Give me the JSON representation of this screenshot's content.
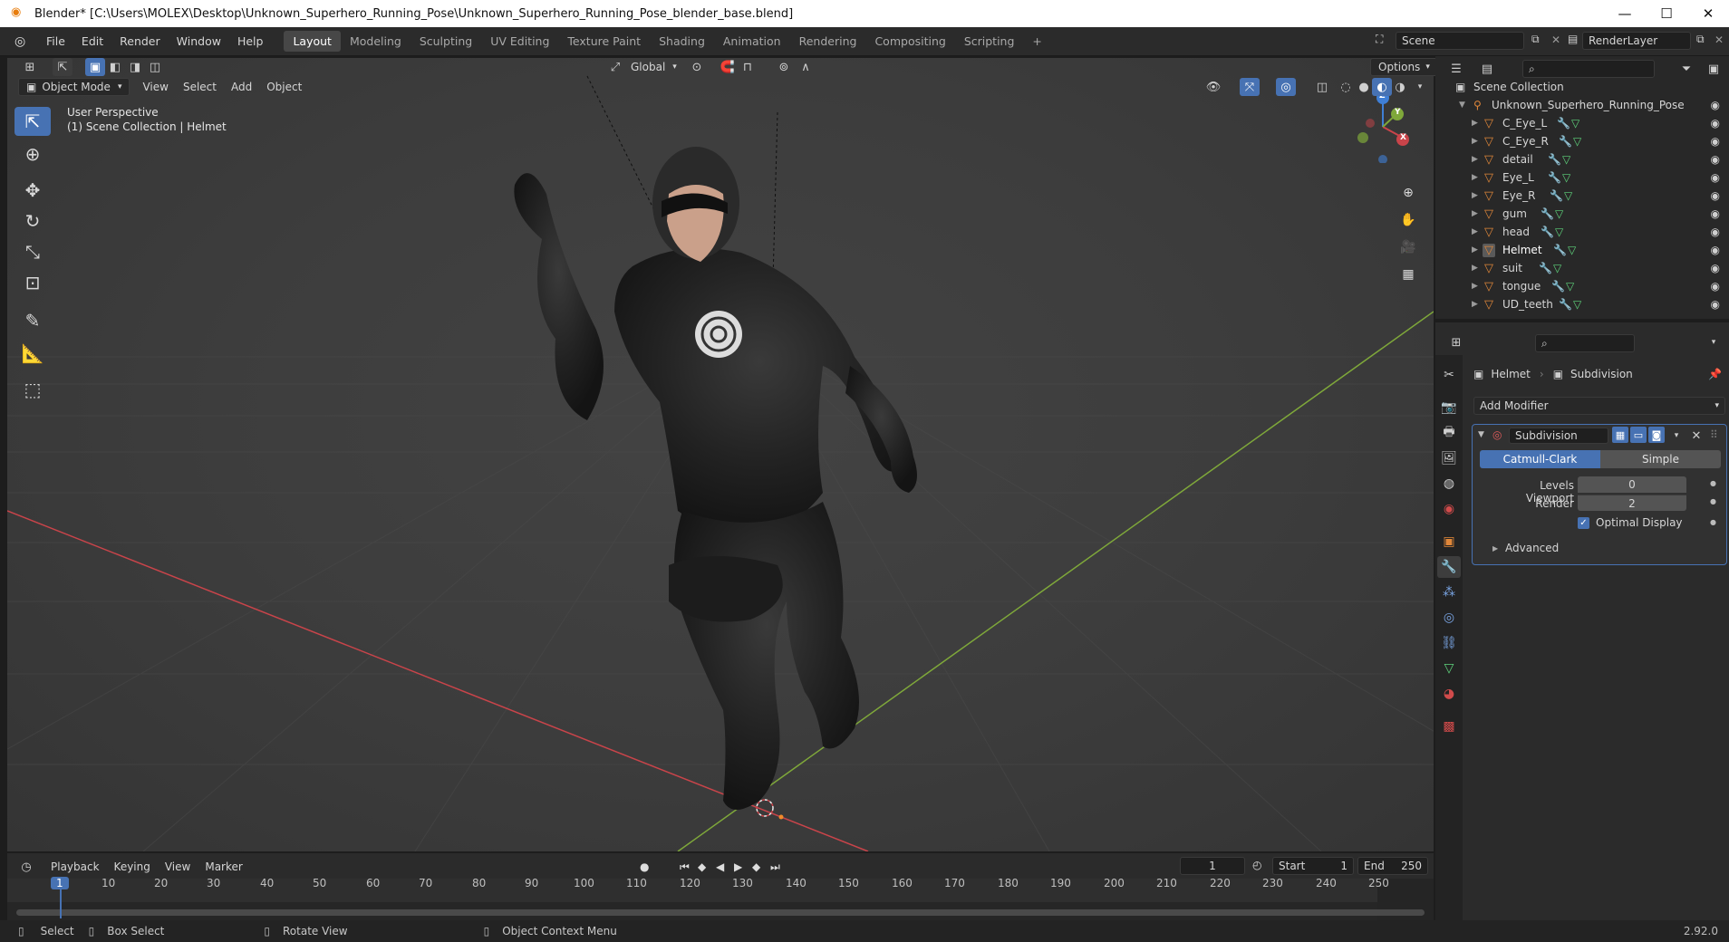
{
  "window": {
    "title": "Blender* [C:\\Users\\MOLEX\\Desktop\\Unknown_Superhero_Running_Pose\\Unknown_Superhero_Running_Pose_blender_base.blend]",
    "minimize": "—",
    "maximize": "☐",
    "close": "✕"
  },
  "menu": [
    "File",
    "Edit",
    "Render",
    "Window",
    "Help"
  ],
  "workspaces": [
    "Layout",
    "Modeling",
    "Sculpting",
    "UV Editing",
    "Texture Paint",
    "Shading",
    "Animation",
    "Rendering",
    "Compositing",
    "Scripting"
  ],
  "add_workspace": "+",
  "scene": {
    "name": "Scene",
    "layer": "RenderLayer"
  },
  "viewport": {
    "transform_orientation": "Global",
    "options_label": "Options",
    "mode": "Object Mode",
    "menus": [
      "View",
      "Select",
      "Add",
      "Object"
    ],
    "overlay_line1": "User Perspective",
    "overlay_line2": "(1) Scene Collection | Helmet",
    "gizmo": {
      "x": "X",
      "y": "Y",
      "z": "Z"
    }
  },
  "outliner": {
    "root": "Scene Collection",
    "collection": "Unknown_Superhero_Running_Pose",
    "objects": [
      "C_Eye_L",
      "C_Eye_R",
      "detail",
      "Eye_L",
      "Eye_R",
      "gum",
      "head",
      "Helmet",
      "suit",
      "tongue",
      "UD_teeth"
    ],
    "active": "Helmet"
  },
  "properties": {
    "breadcrumb_object": "Helmet",
    "breadcrumb_modifier": "Subdivision",
    "add_modifier": "Add Modifier",
    "modifier_name": "Subdivision",
    "method_options": [
      "Catmull-Clark",
      "Simple"
    ],
    "method_selected": "Catmull-Clark",
    "levels_viewport_label": "Levels Viewport",
    "levels_viewport_value": "0",
    "render_label": "Render",
    "render_value": "2",
    "optimal_display_label": "Optimal Display",
    "optimal_display_checked": true,
    "advanced_label": "Advanced"
  },
  "timeline": {
    "menus": [
      "Playback",
      "Keying",
      "View",
      "Marker"
    ],
    "current_frame": "1",
    "start_label": "Start",
    "start_value": "1",
    "end_label": "End",
    "end_value": "250",
    "ruler": [
      "1",
      "10",
      "20",
      "30",
      "40",
      "50",
      "60",
      "70",
      "80",
      "90",
      "100",
      "110",
      "120",
      "130",
      "140",
      "150",
      "160",
      "170",
      "180",
      "190",
      "200",
      "210",
      "220",
      "230",
      "240",
      "250"
    ]
  },
  "statusbar": {
    "select": "Select",
    "box_select": "Box Select",
    "rotate_view": "Rotate View",
    "context_menu": "Object Context Menu",
    "version": "2.92.0"
  },
  "colors": {
    "accent": "#4772b3",
    "x_axis": "#c9444a",
    "y_axis": "#7fa83a",
    "z_axis": "#3f7fd6",
    "object_icon": "#e0873a",
    "mesh_icon": "#5fd47c"
  }
}
